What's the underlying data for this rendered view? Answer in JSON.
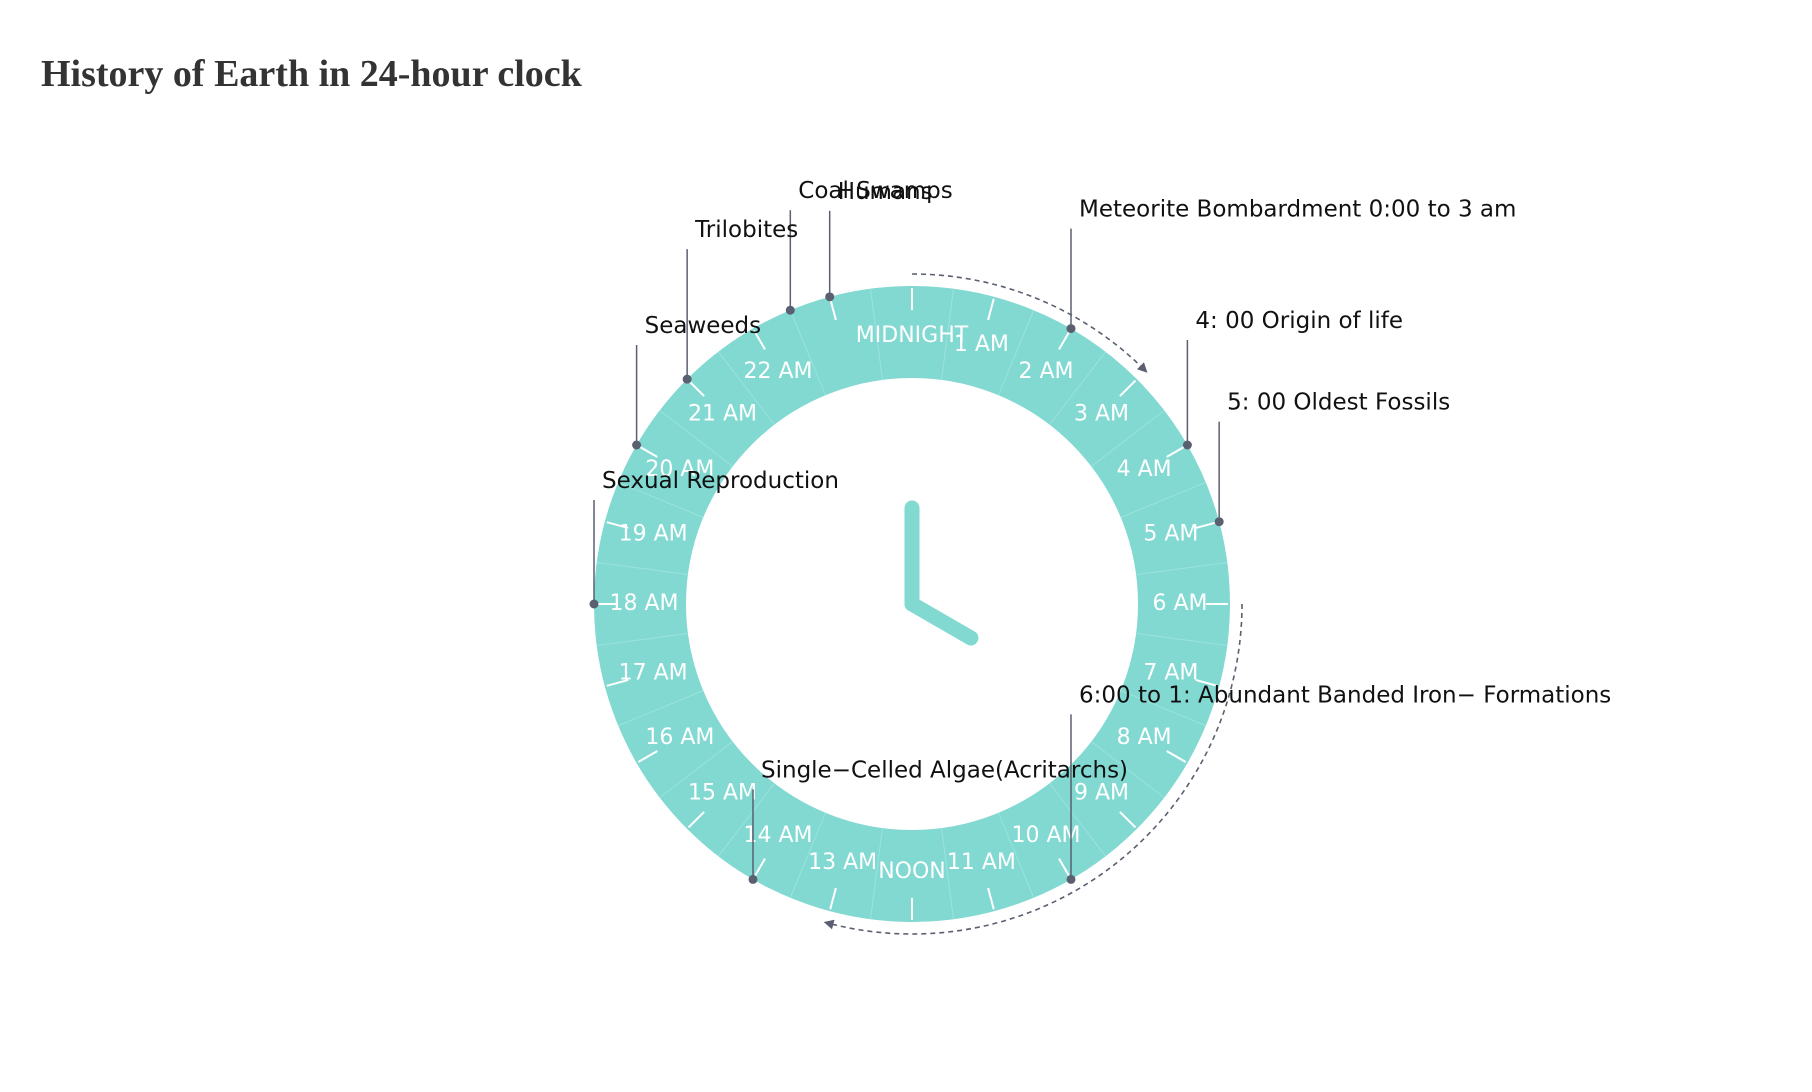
{
  "title": "History of Earth in 24-hour clock",
  "colors": {
    "ring": "#82d9d2",
    "hand": "#82d9d2",
    "tick": "#ffffff",
    "divider": "#9ae3dc",
    "leader": "#5b6070",
    "arrow": "#5b6070",
    "title": "#333333"
  },
  "hours": [
    {
      "hour": 0,
      "label": "MIDNIGHT"
    },
    {
      "hour": 1,
      "label": "1 AM"
    },
    {
      "hour": 2,
      "label": "2 AM"
    },
    {
      "hour": 3,
      "label": "3 AM"
    },
    {
      "hour": 4,
      "label": "4 AM"
    },
    {
      "hour": 5,
      "label": "5 AM"
    },
    {
      "hour": 6,
      "label": "6 AM"
    },
    {
      "hour": 7,
      "label": "7 AM"
    },
    {
      "hour": 8,
      "label": "8 AM"
    },
    {
      "hour": 9,
      "label": "9 AM"
    },
    {
      "hour": 10,
      "label": "10 AM"
    },
    {
      "hour": 11,
      "label": "11 AM"
    },
    {
      "hour": 12,
      "label": "NOON"
    },
    {
      "hour": 13,
      "label": "13 AM"
    },
    {
      "hour": 14,
      "label": "14 AM"
    },
    {
      "hour": 15,
      "label": "15 AM"
    },
    {
      "hour": 16,
      "label": "16 AM"
    },
    {
      "hour": 17,
      "label": "17 AM"
    },
    {
      "hour": 18,
      "label": "18 AM"
    },
    {
      "hour": 19,
      "label": "19 AM"
    },
    {
      "hour": 20,
      "label": "20 AM"
    },
    {
      "hour": 21,
      "label": "21 AM"
    },
    {
      "hour": 22,
      "label": "22 AM"
    }
  ],
  "events": [
    {
      "hour": 23.0,
      "label": "Humans"
    },
    {
      "hour": 22.5,
      "label": "Coal Swamps"
    },
    {
      "hour": 21.0,
      "label": "Trilobites"
    },
    {
      "hour": 20.0,
      "label": "Seaweeds"
    },
    {
      "hour": 18.0,
      "label": "Sexual Reproduction"
    },
    {
      "hour": 14.0,
      "label": "Single−Celled Algae(Acritarchs)"
    },
    {
      "hour": 2.0,
      "label": "Meteorite Bombardment 0:00 to 3 am"
    },
    {
      "hour": 4.0,
      "label": "4: 00 Origin of life"
    },
    {
      "hour": 5.0,
      "label": "5: 00 Oldest Fossils"
    },
    {
      "hour": 10.0,
      "label": "6:00 to 1: Abundant Banded Iron− Formations"
    }
  ],
  "spans": [
    {
      "from_hour": 0,
      "to_hour": 3,
      "name": "Meteorite Bombardment"
    },
    {
      "from_hour": 6,
      "to_hour": 13,
      "name": "Abundant Banded Iron Formations"
    }
  ],
  "hands": {
    "hour_hand_hour": 16,
    "minute_hand_minute": 0
  }
}
